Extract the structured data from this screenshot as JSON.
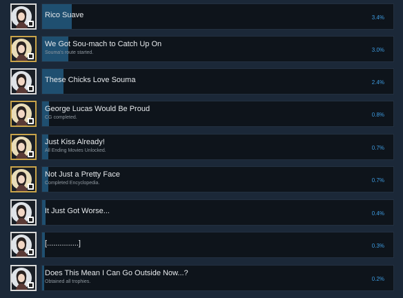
{
  "achievements": [
    {
      "name": "Rico Suave",
      "description": "",
      "percent_text": "3.4%",
      "percent": 3.4,
      "icon": "achievement-portrait-icon",
      "frame": "silver"
    },
    {
      "name": "We Got Sou-mach to Catch Up On",
      "description": "Souma's route started.",
      "percent_text": "3.0%",
      "percent": 3.0,
      "icon": "achievement-portrait-icon",
      "frame": "gold"
    },
    {
      "name": "These Chicks Love Souma",
      "description": "",
      "percent_text": "2.4%",
      "percent": 2.4,
      "icon": "achievement-portrait-icon",
      "frame": "silver"
    },
    {
      "name": "George Lucas Would Be Proud",
      "description": "CG completed.",
      "percent_text": "0.8%",
      "percent": 0.8,
      "icon": "achievement-portrait-icon",
      "frame": "gold"
    },
    {
      "name": "Just Kiss Already!",
      "description": "All Ending Movies Unlocked.",
      "percent_text": "0.7%",
      "percent": 0.7,
      "icon": "achievement-portrait-icon",
      "frame": "gold"
    },
    {
      "name": "Not Just a Pretty Face",
      "description": "Completed Encyclopedia.",
      "percent_text": "0.7%",
      "percent": 0.7,
      "icon": "achievement-portrait-icon",
      "frame": "gold"
    },
    {
      "name": "It Just Got Worse...",
      "description": "",
      "percent_text": "0.4%",
      "percent": 0.4,
      "icon": "achievement-portrait-icon",
      "frame": "silver"
    },
    {
      "name": "[...............]",
      "description": "",
      "percent_text": "0.3%",
      "percent": 0.3,
      "icon": "achievement-portrait-icon",
      "frame": "silver"
    },
    {
      "name": "Does This Mean I Can Go Outside Now...?",
      "description": "Obtained all trophies.",
      "percent_text": "0.2%",
      "percent": 0.2,
      "icon": "achievement-portrait-icon",
      "frame": "silver"
    }
  ],
  "colors": {
    "background": "#1b2838",
    "card": "#0e141b",
    "progress_fill": "#1f4f70",
    "percent_text": "#3d9be0",
    "title_text": "#e6e9ec",
    "description_text": "#8f98a0",
    "frame_gold": "#c9a44a",
    "frame_silver": "#d9d9d9"
  }
}
